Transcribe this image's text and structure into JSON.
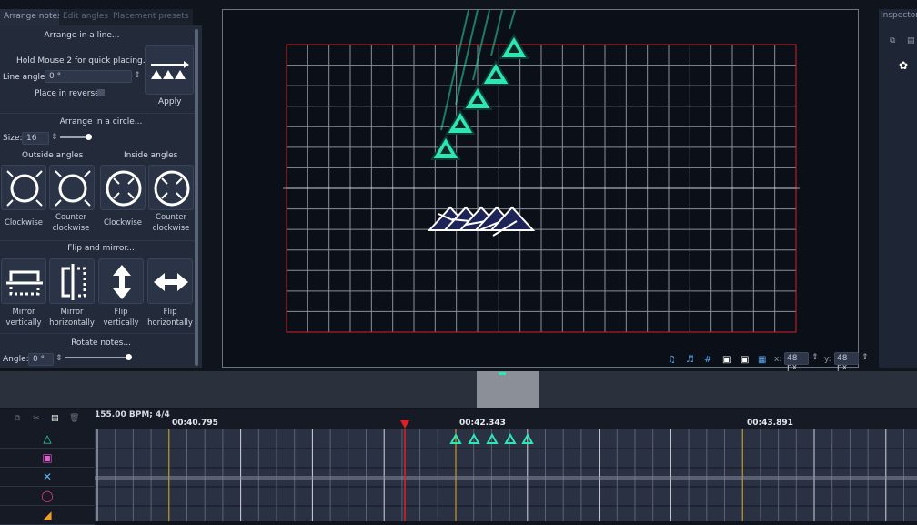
{
  "tabs": [
    "Arrange notes",
    "Edit angles",
    "Placement presets"
  ],
  "line": {
    "title": "Arrange in a line...",
    "hint": "Hold Mouse 2 for quick placing.",
    "angle_label": "Line angle:",
    "angle_value": "0 °",
    "reverse_label": "Place in reverse:",
    "apply_label": "Apply"
  },
  "circle": {
    "title": "Arrange in a circle...",
    "size_label": "Size:",
    "size_value": "16",
    "outside_label": "Outside angles",
    "inside_label": "Inside angles",
    "buttons": [
      "Clockwise",
      "Counter clockwise",
      "Clockwise",
      "Counter clockwise"
    ],
    "slider_fraction": 0.95
  },
  "flip": {
    "title": "Flip and mirror...",
    "buttons": [
      "Mirror vertically",
      "Mirror horizontally",
      "Flip vertically",
      "Flip horizontally"
    ]
  },
  "rotate": {
    "title": "Rotate notes...",
    "angle_label": "Angle:",
    "angle_value": "0 °",
    "slider_fraction": 1.0
  },
  "inspector": {
    "title": "Inspector"
  },
  "canvas_toolbar": {
    "x_label": "x:",
    "x_value": "48 px",
    "y_label": "y:",
    "y_value": "48 px"
  },
  "timeline": {
    "bpm": "155.00 BPM; 4/4",
    "times": [
      "00:40.795",
      "00:42.343",
      "00:43.891"
    ],
    "lanes": [
      "triangle",
      "square",
      "cross",
      "circle",
      "slide"
    ]
  },
  "colors": {
    "triangle": "#2ee6b4",
    "square": "#e65ad2",
    "cross": "#5ab4f0",
    "circle": "#f03c78",
    "grid_border": "#d0202a",
    "playhead": "#e02020",
    "beat": "#e0b020"
  }
}
